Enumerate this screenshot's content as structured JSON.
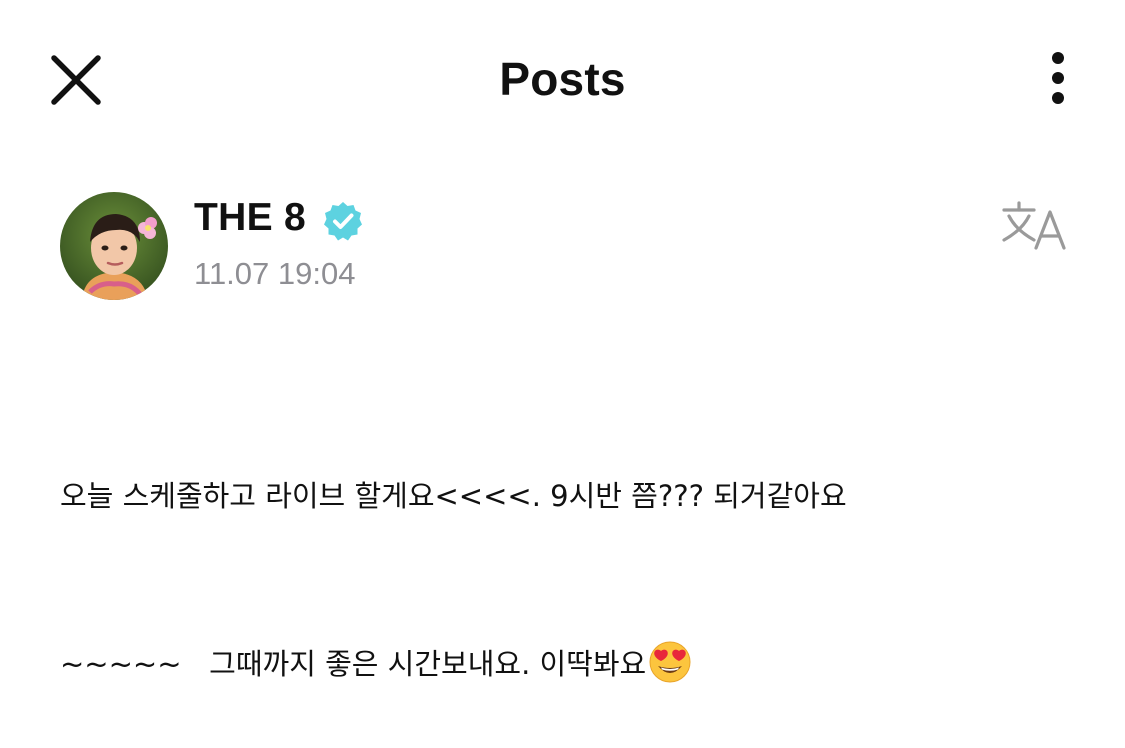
{
  "header": {
    "title": "Posts",
    "close_icon": "close-icon",
    "more_icon": "more-vertical-icon"
  },
  "post": {
    "author": {
      "name": "THE 8",
      "verified": true,
      "verified_color": "#5dd2e0",
      "avatar": "avatar-photo"
    },
    "timestamp": "11.07 19:04",
    "translate_icon": "translate-icon",
    "body_lines": [
      "오늘 스케줄하고 라이브 할게요<<<<. 9시반 쯤??? 되거같아요",
      "~~~~~   그때까지 좋은 시간보내요. 이딱봐요"
    ],
    "emoji": "heart-eyes-emoji"
  },
  "colors": {
    "background": "#ffffff",
    "text": "#111111",
    "muted": "#8e8e93"
  }
}
